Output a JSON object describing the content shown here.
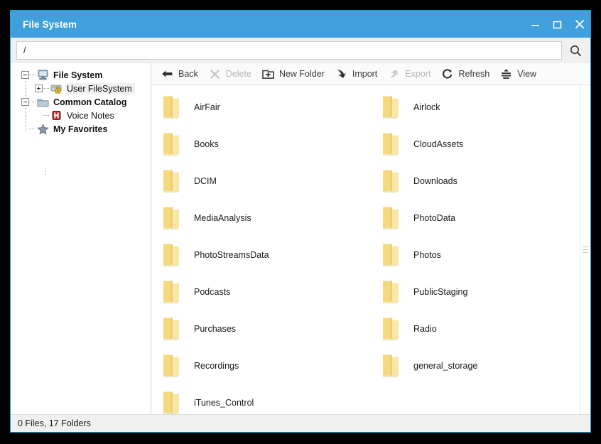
{
  "window": {
    "title": "File System",
    "accent_color": "#3fa0db",
    "controls": [
      {
        "name": "minimize-button",
        "glyph": "minimize"
      },
      {
        "name": "maximize-button",
        "glyph": "maximize"
      },
      {
        "name": "close-button",
        "glyph": "close"
      }
    ]
  },
  "address": {
    "value": "/",
    "placeholder": "",
    "search_icon": "search-icon"
  },
  "sidebar": {
    "items": [
      {
        "label": "File System",
        "icon": "computer-icon",
        "toggle": "minus",
        "depth": 0,
        "bold": true,
        "selected": false
      },
      {
        "label": "User FileSystem",
        "icon": "locked-drive-icon",
        "toggle": "plus",
        "depth": 1,
        "bold": false,
        "selected": true
      },
      {
        "label": "Common Catalog",
        "icon": "folder-icon",
        "toggle": "minus",
        "depth": 0,
        "bold": true,
        "selected": false
      },
      {
        "label": "Voice Notes",
        "icon": "voice-notes-icon",
        "toggle": "none",
        "depth": 1,
        "bold": false,
        "selected": false
      },
      {
        "label": "My Favorites",
        "icon": "star-icon",
        "toggle": "none",
        "depth": 0,
        "bold": true,
        "selected": false
      }
    ]
  },
  "toolbar": {
    "buttons": [
      {
        "label": "Back",
        "icon": "back-arrow-icon",
        "disabled": false
      },
      {
        "label": "Delete",
        "icon": "delete-x-icon",
        "disabled": true
      },
      {
        "label": "New Folder",
        "icon": "new-folder-icon",
        "disabled": false
      },
      {
        "label": "Import",
        "icon": "import-arrow-icon",
        "disabled": false
      },
      {
        "label": "Export",
        "icon": "export-arrow-icon",
        "disabled": true
      },
      {
        "label": "Refresh",
        "icon": "refresh-icon",
        "disabled": false
      },
      {
        "label": "View",
        "icon": "view-icon",
        "disabled": false
      }
    ]
  },
  "files": {
    "items": [
      {
        "name": "AirFair",
        "icon": "folder-icon"
      },
      {
        "name": "Airlock",
        "icon": "folder-icon"
      },
      {
        "name": "Books",
        "icon": "folder-icon"
      },
      {
        "name": "CloudAssets",
        "icon": "folder-icon"
      },
      {
        "name": "DCIM",
        "icon": "folder-icon"
      },
      {
        "name": "Downloads",
        "icon": "folder-icon"
      },
      {
        "name": "MediaAnalysis",
        "icon": "folder-icon"
      },
      {
        "name": "PhotoData",
        "icon": "folder-icon"
      },
      {
        "name": "PhotoStreamsData",
        "icon": "folder-icon"
      },
      {
        "name": "Photos",
        "icon": "folder-icon"
      },
      {
        "name": "Podcasts",
        "icon": "folder-icon"
      },
      {
        "name": "PublicStaging",
        "icon": "folder-icon"
      },
      {
        "name": "Purchases",
        "icon": "folder-icon"
      },
      {
        "name": "Radio",
        "icon": "folder-icon"
      },
      {
        "name": "Recordings",
        "icon": "folder-icon"
      },
      {
        "name": "general_storage",
        "icon": "folder-icon"
      },
      {
        "name": "iTunes_Control",
        "icon": "folder-icon"
      }
    ]
  },
  "status": {
    "text": "0 Files, 17 Folders"
  }
}
